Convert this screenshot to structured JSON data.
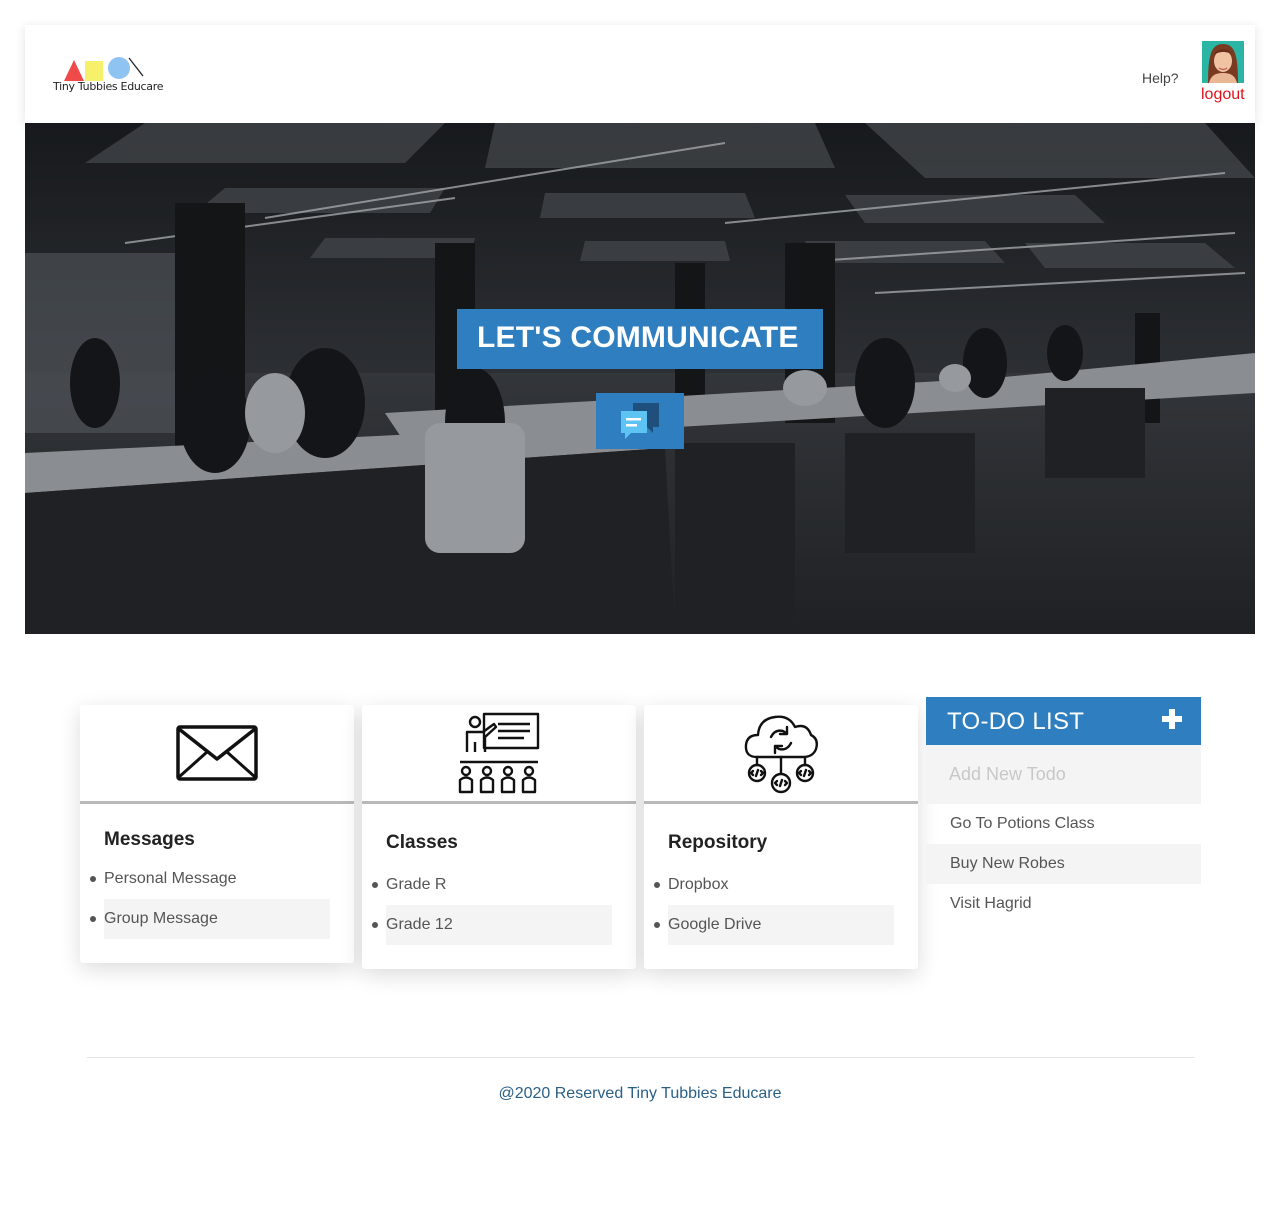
{
  "header": {
    "logo_text": "Tiny Tubbies Educare",
    "help_label": "Help?",
    "logout_label": "logout"
  },
  "hero": {
    "title": "LET'S COMMUNICATE"
  },
  "cards": [
    {
      "title": "Messages",
      "icon": "envelope-icon",
      "items": [
        "Personal Message",
        "Group Message"
      ]
    },
    {
      "title": "Classes",
      "icon": "teacher-class-icon",
      "items": [
        "Grade R",
        "Grade 12"
      ]
    },
    {
      "title": "Repository",
      "icon": "cloud-code-icon",
      "items": [
        "Dropbox",
        "Google Drive"
      ]
    }
  ],
  "todo": {
    "title": "TO-DO LIST",
    "input_placeholder": "Add New Todo",
    "items": [
      "Go To Potions Class",
      "Buy New Robes",
      "Visit Hagrid"
    ]
  },
  "footer": {
    "text": "@2020 Reserved Tiny Tubbies Educare"
  },
  "colors": {
    "accent": "#2f7fc0",
    "logout": "#e0131b",
    "footer_text": "#2a5f86"
  }
}
